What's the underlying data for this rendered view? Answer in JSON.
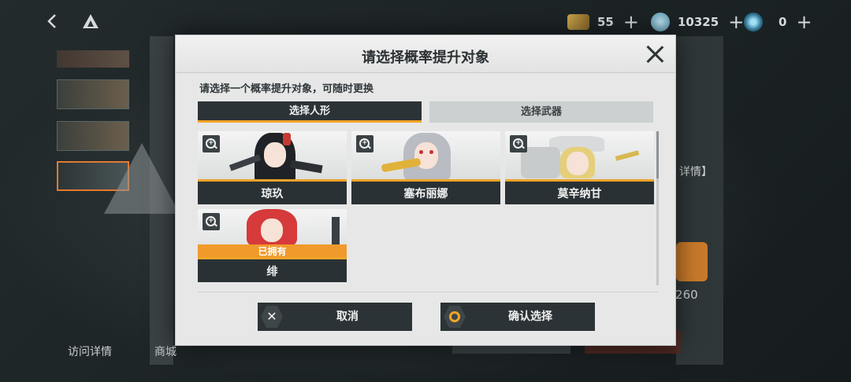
{
  "topbar": {
    "currencies": [
      {
        "name": "ticket-icon",
        "value": "55"
      },
      {
        "name": "crystal-icon",
        "value": "10325"
      },
      {
        "name": "orb-icon",
        "value": "0"
      }
    ],
    "plus_label": "+"
  },
  "background": {
    "visit_label": "访问详情",
    "shop_label": "商城",
    "detail_label": "详情】",
    "count_label": "/260"
  },
  "dialog": {
    "title": "请选择概率提升对象",
    "subtitle": "请选择一个概率提升对象，可随时更换",
    "tabs": [
      {
        "label": "选择人形",
        "active": true
      },
      {
        "label": "选择武器",
        "active": false
      }
    ],
    "cards": [
      {
        "name": "琼玖",
        "owned": false
      },
      {
        "name": "塞布丽娜",
        "owned": false
      },
      {
        "name": "莫辛纳甘",
        "owned": false
      },
      {
        "name": "绯",
        "owned": true
      }
    ],
    "owned_label": "已拥有",
    "cancel_label": "取消",
    "confirm_label": "确认选择",
    "accent_color": "#f3a428",
    "dark_color": "#2c3336"
  }
}
